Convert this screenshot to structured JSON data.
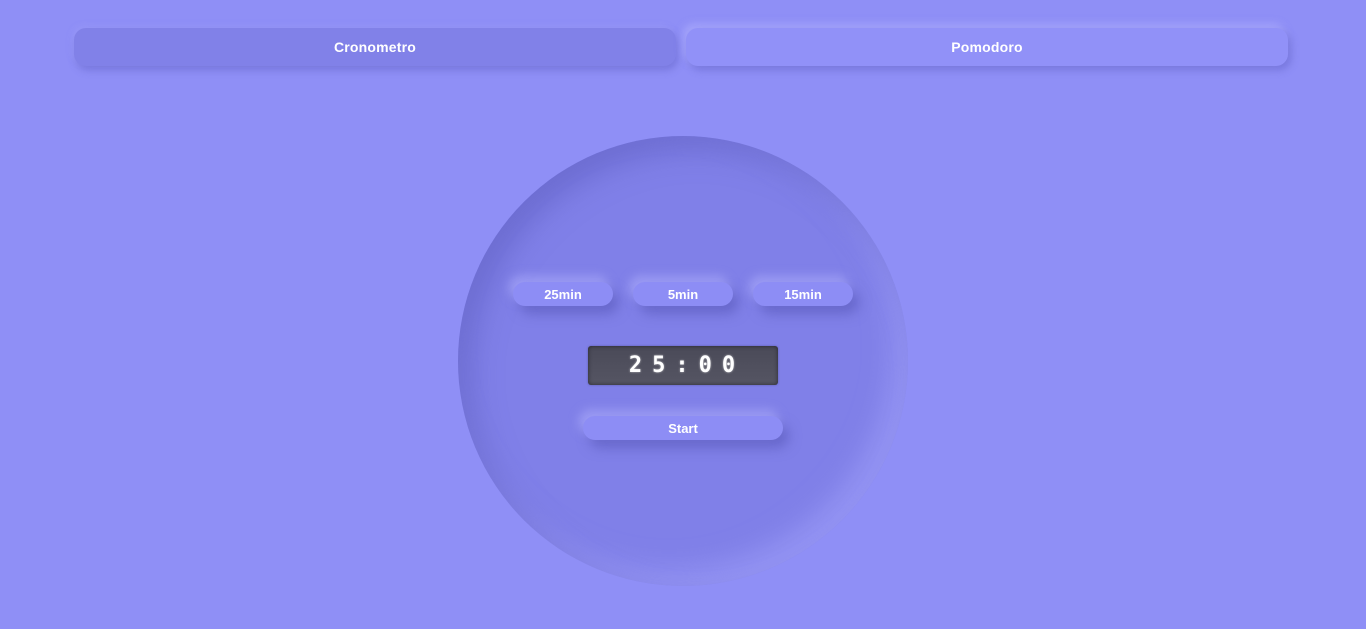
{
  "nav": {
    "tabs": [
      {
        "label": "Cronometro",
        "active": true
      },
      {
        "label": "Pomodoro",
        "active": false
      }
    ]
  },
  "pomodoro": {
    "presets": [
      "25min",
      "5min",
      "15min"
    ],
    "timer_display": "25:00",
    "start_label": "Start"
  },
  "colors": {
    "background": "#8f8ff6",
    "active_tab": "#8181e8",
    "inactive_tab": "#9191f8",
    "dial": "#8080e8",
    "timer_display": "#4a4a58",
    "text": "#ffffff"
  }
}
